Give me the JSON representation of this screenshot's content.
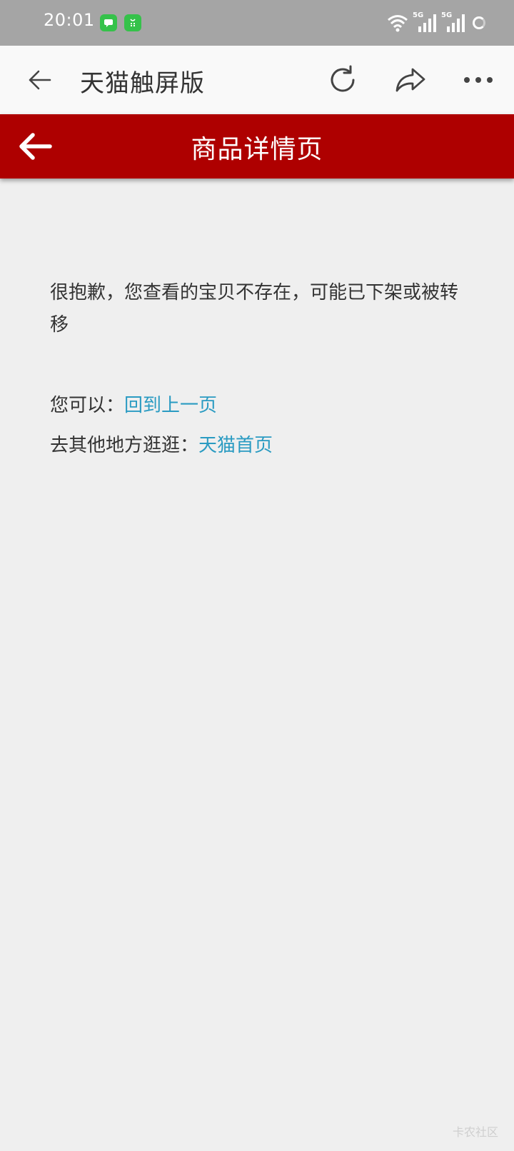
{
  "status_bar": {
    "time": "20:01",
    "network_1": "5G",
    "network_2": "5G"
  },
  "browser": {
    "title": "天猫触屏版"
  },
  "header": {
    "title": "商品详情页"
  },
  "content": {
    "message": "很抱歉，您查看的宝贝不存在，可能已下架或被转移",
    "option1_label": "您可以：",
    "option1_link": "回到上一页",
    "option2_label": "去其他地方逛逛：",
    "option2_link": "天猫首页"
  },
  "watermark": "卡农社区",
  "colors": {
    "header_red": "#ae0000",
    "link_blue": "#2a9bc2",
    "status_bar": "#a5a5a5"
  }
}
